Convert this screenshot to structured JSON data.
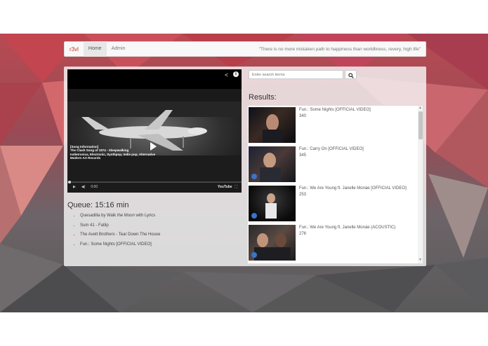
{
  "navbar": {
    "brand": "r3vl",
    "links": [
      {
        "label": "Home",
        "active": true
      },
      {
        "label": "Admin",
        "active": false
      }
    ],
    "quote": "\"There is no more mistaken path to happiness than worldliness, revery, high life\""
  },
  "player": {
    "song_info": [
      "[Song Information]",
      "The Clash Song of 1974 - Sleepwalking",
      "Indietronica, Electronic, Synthpop, Indie pop, Alternative",
      "Modern Art Records"
    ],
    "time": "0:00",
    "youtube_label": "YouTube"
  },
  "queue": {
    "title": "Queue: 15:16 min",
    "items": [
      "Quesadilla by Walk the Moon with Lyrics",
      "Sum 41 - Fatlip",
      "The Avett Brothers - Tear Down The House",
      "Fun.: Some Nights [OFFICIAL VIDEO]"
    ]
  },
  "search": {
    "placeholder": "Enter search terms"
  },
  "results": {
    "title": "Results:",
    "items": [
      {
        "title": "Fun.: Some Nights [OFFICIAL VIDEO]",
        "views": "340"
      },
      {
        "title": "Fun.: Carry On [OFFICIAL VIDEO]",
        "views": "345"
      },
      {
        "title": "Fun.: We Are Young ft. Janelle Monáe [OFFICIAL VIDEO]",
        "views": "253"
      },
      {
        "title": "Fun.: We Are Young ft. Janelle Monáe (ACOUSTIC)",
        "views": "276"
      }
    ]
  },
  "colors": {
    "brand": "#c0392b",
    "background_top": "#b84a52",
    "background_bottom": "#5a5a5a"
  }
}
